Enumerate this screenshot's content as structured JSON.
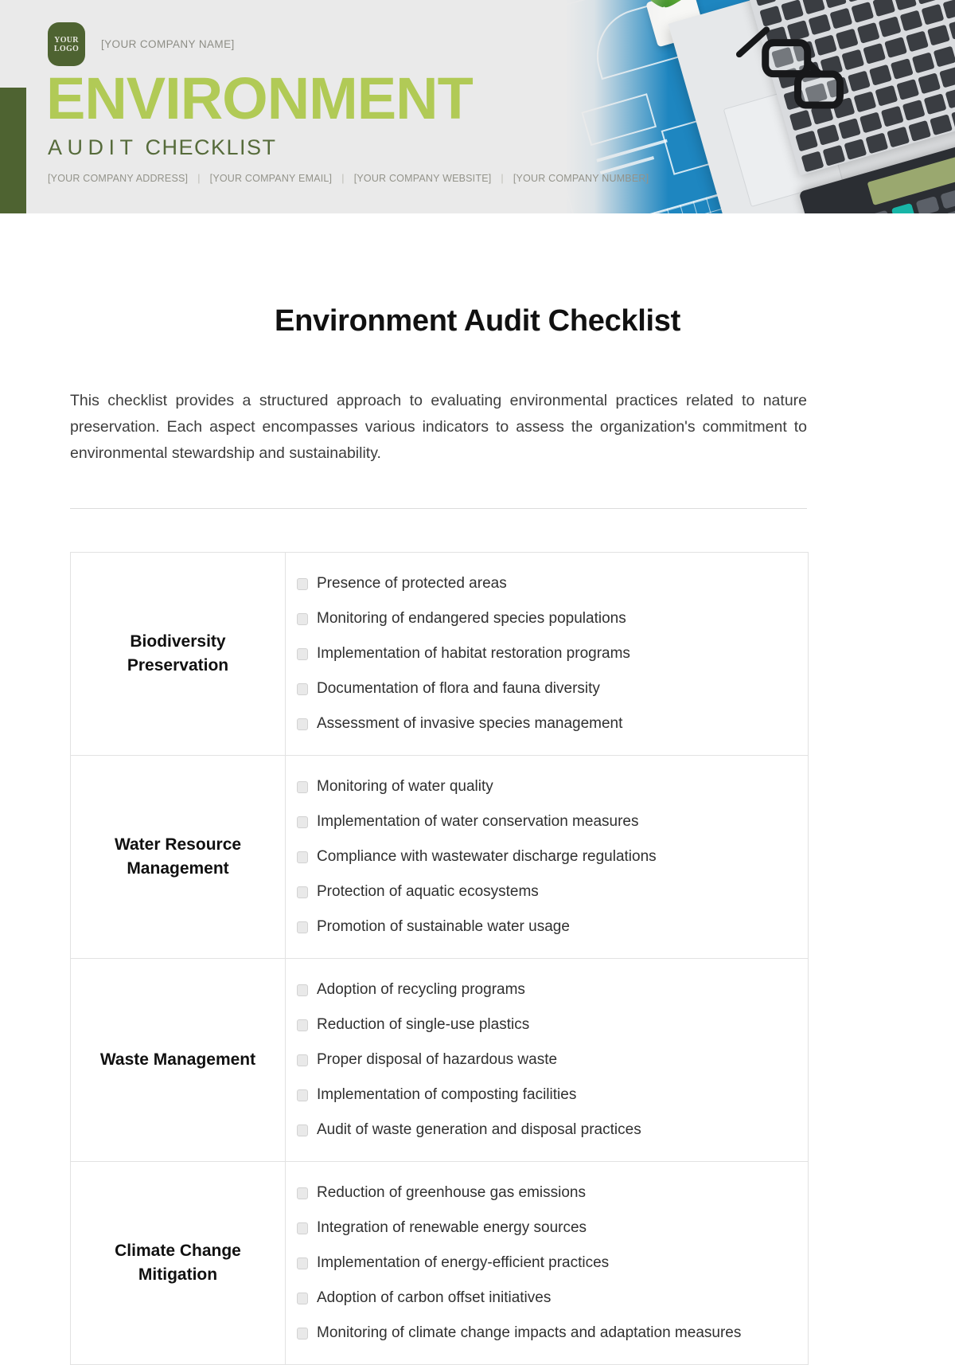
{
  "header": {
    "logo_text_line1": "YOUR",
    "logo_text_line2": "LOGO",
    "company_name": "[YOUR COMPANY NAME]",
    "title": "ENVIRONMENT",
    "subtitle_spaced": "AUDIT",
    "subtitle_rest": "CHECKLIST",
    "contacts": [
      "[YOUR COMPANY ADDRESS]",
      "[YOUR COMPANY EMAIL]",
      "[YOUR COMPANY WEBSITE]",
      "[YOUR COMPANY NUMBER]"
    ],
    "separator": "|",
    "colors": {
      "band_bg": "#eaeaea",
      "bright_green": "#b1ca56",
      "dark_olive": "#4e6331",
      "subtitle_green": "#566b3b",
      "contact_gray": "#93938a"
    }
  },
  "document": {
    "title": "Environment Audit Checklist",
    "intro": "This checklist provides a structured approach to evaluating environmental practices related to nature preservation. Each aspect encompasses various indicators to assess the organization's commitment to environmental stewardship and sustainability."
  },
  "checklist": {
    "sections": [
      {
        "category": "Biodiversity Preservation",
        "items": [
          "Presence of protected areas",
          "Monitoring of endangered species populations",
          "Implementation of habitat restoration programs",
          "Documentation of flora and fauna diversity",
          "Assessment of invasive species management"
        ]
      },
      {
        "category": "Water Resource Management",
        "items": [
          "Monitoring of water quality",
          "Implementation of water conservation measures",
          "Compliance with wastewater discharge regulations",
          "Protection of aquatic ecosystems",
          "Promotion of sustainable water usage"
        ]
      },
      {
        "category": "Waste Management",
        "items": [
          "Adoption of recycling programs",
          "Reduction of single-use plastics",
          "Proper disposal of hazardous waste",
          "Implementation of composting facilities",
          "Audit of waste generation and disposal practices"
        ]
      },
      {
        "category": "Climate Change Mitigation",
        "items": [
          "Reduction of greenhouse gas emissions",
          "Integration of renewable energy sources",
          "Implementation of energy-efficient practices",
          "Adoption of carbon offset initiatives",
          "Monitoring of climate change impacts and adaptation measures"
        ]
      }
    ]
  }
}
